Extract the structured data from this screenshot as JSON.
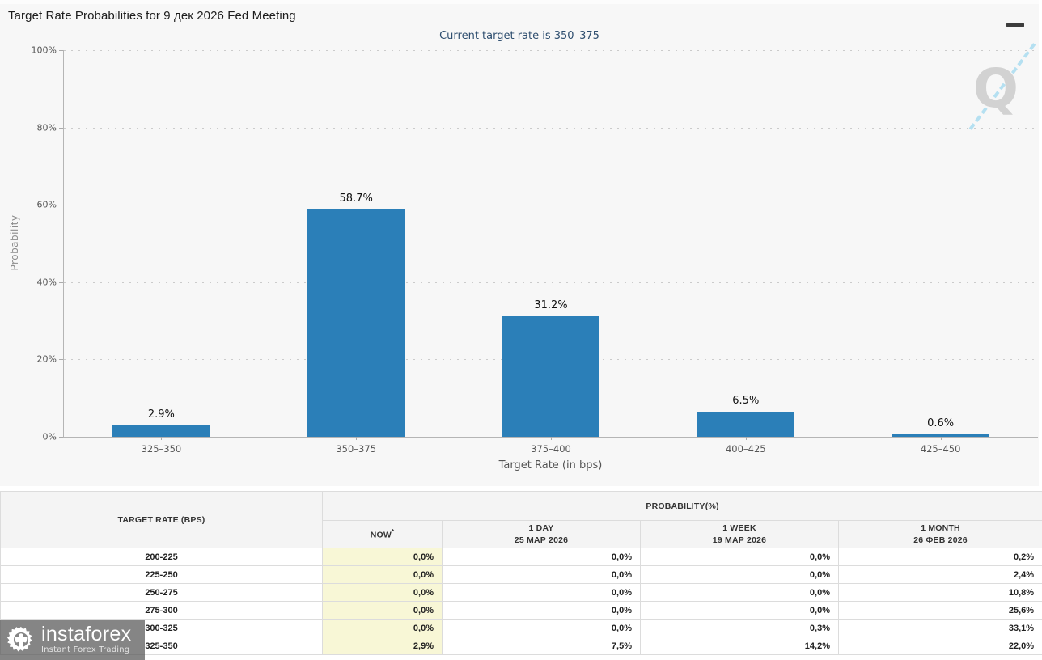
{
  "header": {
    "title": "Target Rate Probabilities for 9 дек 2026 Fed Meeting"
  },
  "chart_data": {
    "type": "bar",
    "title": "Target Rate Probabilities for 9 дек 2026 Fed Meeting",
    "subtitle": "Current target rate is 350–375",
    "categories": [
      "325–350",
      "350–375",
      "375–400",
      "400–425",
      "425–450"
    ],
    "values": [
      2.9,
      58.7,
      31.2,
      6.5,
      0.6
    ],
    "bar_labels": [
      "2.9%",
      "58.7%",
      "31.2%",
      "6.5%",
      "0.6%"
    ],
    "xlabel": "Target Rate (in bps)",
    "ylabel": "Probability",
    "ylim": [
      0,
      100
    ],
    "yticks": [
      "0%",
      "20%",
      "40%",
      "60%",
      "80%",
      "100%"
    ],
    "grid": "dotted-horizontal",
    "legend": "none",
    "bar_color": "#2b7fb8",
    "watermark_letter": "Q"
  },
  "table": {
    "header": {
      "target_rate": "TARGET RATE (BPS)",
      "probability_group": "PROBABILITY(%)",
      "now_label": "NOW",
      "now_asterisk": "*",
      "col_1day_label": "1 DAY",
      "col_1day_date": "25 МАР 2026",
      "col_1week_label": "1 WEEK",
      "col_1week_date": "19 МАР 2026",
      "col_1month_label": "1 MONTH",
      "col_1month_date": "26 ФЕВ 2026"
    },
    "rows": [
      {
        "range": "200-225",
        "now": "0,0%",
        "day": "0,0%",
        "week": "0,0%",
        "month": "0,2%"
      },
      {
        "range": "225-250",
        "now": "0,0%",
        "day": "0,0%",
        "week": "0,0%",
        "month": "2,4%"
      },
      {
        "range": "250-275",
        "now": "0,0%",
        "day": "0,0%",
        "week": "0,0%",
        "month": "10,8%"
      },
      {
        "range": "275-300",
        "now": "0,0%",
        "day": "0,0%",
        "week": "0,0%",
        "month": "25,6%"
      },
      {
        "range": "300-325",
        "now": "0,0%",
        "day": "0,0%",
        "week": "0,3%",
        "month": "33,1%"
      },
      {
        "range": "325-350",
        "now": "2,9%",
        "day": "7,5%",
        "week": "14,2%",
        "month": "22,0%"
      }
    ]
  },
  "branding": {
    "logo_text": "instaforex",
    "tagline": "Instant Forex Trading"
  },
  "colors": {
    "bar": "#2b7fb8",
    "subtitle_text": "#2e4e6f",
    "now_cell_bg": "#f8f7d6",
    "chart_bg": "#f7f7f7",
    "q_watermark": "#d2d2d2",
    "q_dashes": "#aadcf0"
  }
}
